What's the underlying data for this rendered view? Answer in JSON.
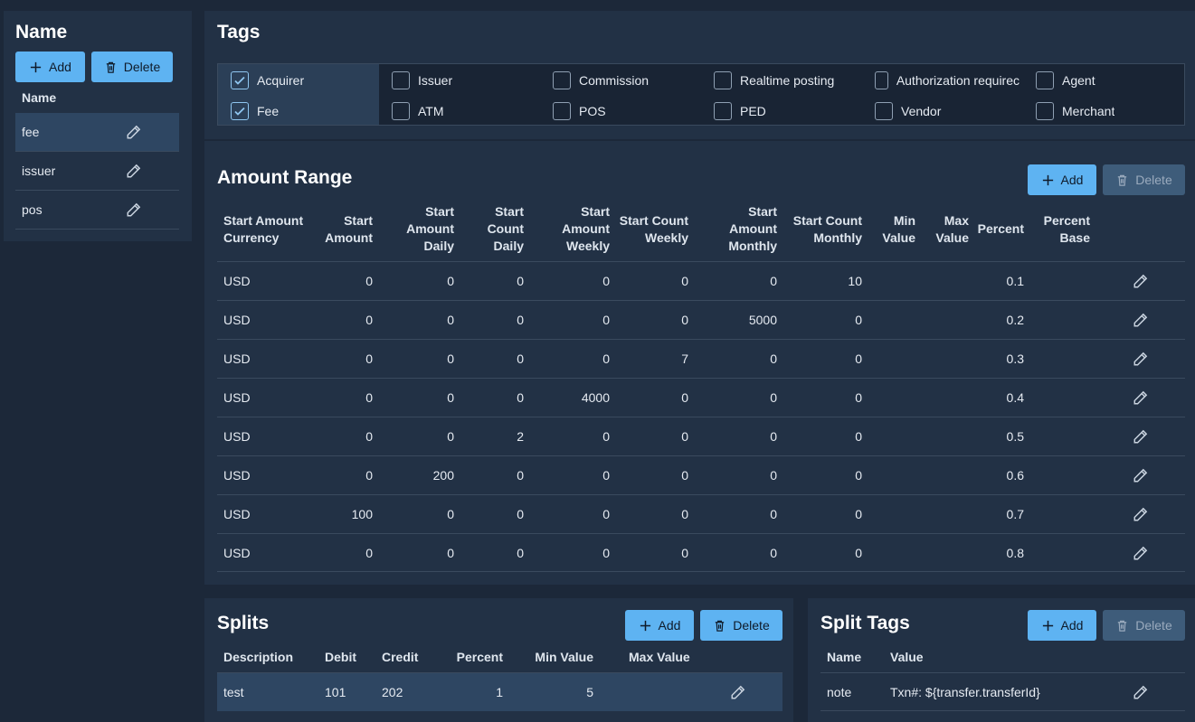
{
  "name_panel": {
    "title": "Name",
    "add_label": "Add",
    "delete_label": "Delete",
    "column_header": "Name",
    "rows": [
      "fee",
      "issuer",
      "pos"
    ],
    "selected_row": "fee"
  },
  "tags": {
    "title": "Tags",
    "items": [
      {
        "label": "Acquirer",
        "checked": true
      },
      {
        "label": "Issuer",
        "checked": false
      },
      {
        "label": "Commission",
        "checked": false
      },
      {
        "label": "Realtime posting",
        "checked": false
      },
      {
        "label": "Authorization requirec",
        "checked": false
      },
      {
        "label": "Agent",
        "checked": false
      },
      {
        "label": "Fee",
        "checked": true
      },
      {
        "label": "ATM",
        "checked": false
      },
      {
        "label": "POS",
        "checked": false
      },
      {
        "label": "PED",
        "checked": false
      },
      {
        "label": "Vendor",
        "checked": false
      },
      {
        "label": "Merchant",
        "checked": false
      }
    ]
  },
  "amount_range": {
    "title": "Amount Range",
    "add_label": "Add",
    "delete_label": "Delete",
    "headers": [
      "Start Amount\nCurrency",
      "Start\nAmount",
      "Start\nAmount\nDaily",
      "Start\nCount\nDaily",
      "Start\nAmount\nWeekly",
      "Start Count\nWeekly",
      "Start\nAmount\nMonthly",
      "Start Count\nMonthly",
      "Min\nValue",
      "Max\nValue",
      "Percent",
      "Percent\nBase"
    ],
    "rows": [
      [
        "USD",
        "0",
        "0",
        "0",
        "0",
        "0",
        "0",
        "10",
        "",
        "",
        "0.1",
        ""
      ],
      [
        "USD",
        "0",
        "0",
        "0",
        "0",
        "0",
        "5000",
        "0",
        "",
        "",
        "0.2",
        ""
      ],
      [
        "USD",
        "0",
        "0",
        "0",
        "0",
        "7",
        "0",
        "0",
        "",
        "",
        "0.3",
        ""
      ],
      [
        "USD",
        "0",
        "0",
        "0",
        "4000",
        "0",
        "0",
        "0",
        "",
        "",
        "0.4",
        ""
      ],
      [
        "USD",
        "0",
        "0",
        "2",
        "0",
        "0",
        "0",
        "0",
        "",
        "",
        "0.5",
        ""
      ],
      [
        "USD",
        "0",
        "200",
        "0",
        "0",
        "0",
        "0",
        "0",
        "",
        "",
        "0.6",
        ""
      ],
      [
        "USD",
        "100",
        "0",
        "0",
        "0",
        "0",
        "0",
        "0",
        "",
        "",
        "0.7",
        ""
      ],
      [
        "USD",
        "0",
        "0",
        "0",
        "0",
        "0",
        "0",
        "0",
        "",
        "",
        "0.8",
        ""
      ]
    ]
  },
  "splits": {
    "title": "Splits",
    "add_label": "Add",
    "delete_label": "Delete",
    "headers": [
      "Description",
      "Debit",
      "Credit",
      "Percent",
      "Min Value",
      "Max Value"
    ],
    "rows": [
      [
        "test",
        "101",
        "202",
        "1",
        "5",
        ""
      ]
    ]
  },
  "split_tags": {
    "title": "Split Tags",
    "add_label": "Add",
    "delete_label": "Delete",
    "headers": [
      "Name",
      "Value"
    ],
    "rows": [
      [
        "note",
        "Txn#: ${transfer.transferId}"
      ]
    ]
  },
  "colors": {
    "background": "#1c2839",
    "panel": "#223145",
    "accent": "#5eb3f2",
    "selected_row": "#2e4662"
  }
}
